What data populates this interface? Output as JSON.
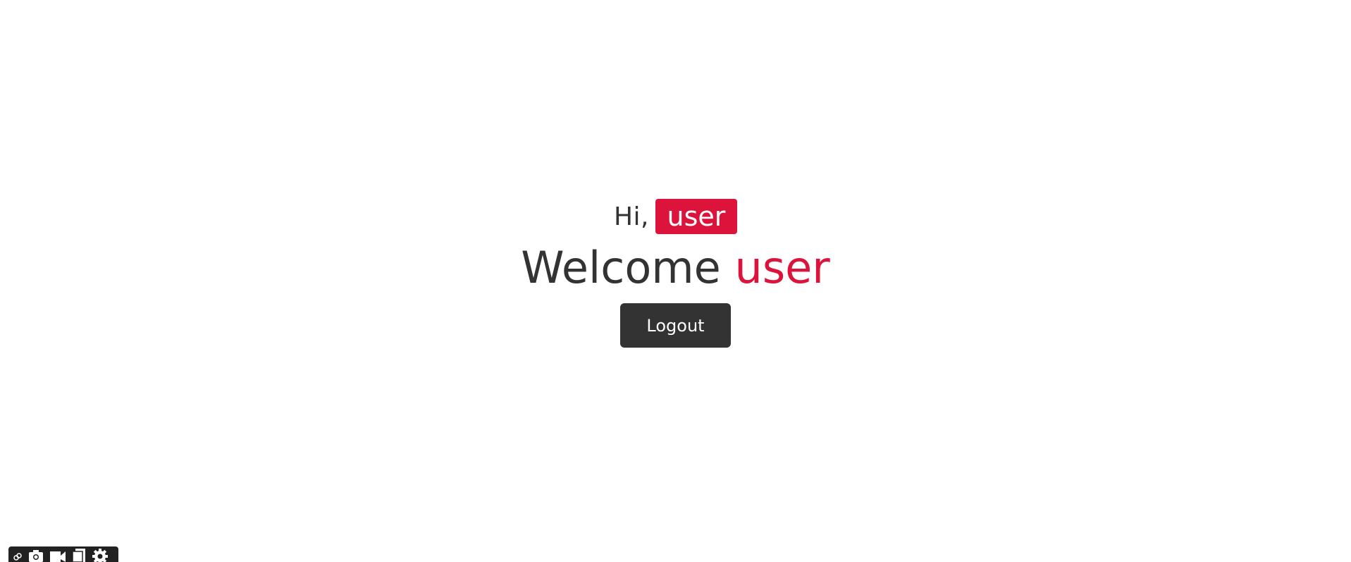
{
  "greeting": {
    "prefix": "Hi,",
    "username": "user"
  },
  "welcome": {
    "text": "Welcome",
    "username": "user"
  },
  "logout": {
    "label": "Logout"
  },
  "colors": {
    "accent": "#dc143c",
    "text": "#333333",
    "button_bg": "#333333",
    "background": "#ffffff"
  },
  "devtools": {
    "icons": [
      "link-icon",
      "camera-icon",
      "video-icon",
      "copy-icon",
      "gear-icon"
    ]
  }
}
